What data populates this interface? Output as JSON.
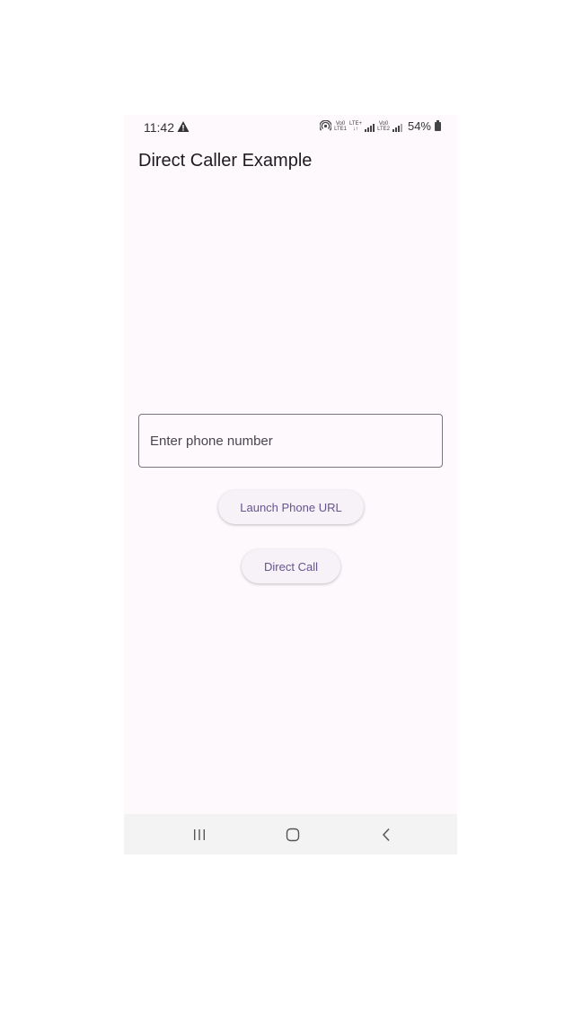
{
  "status_bar": {
    "time": "11:42",
    "battery_percent": "54%",
    "network_label_1_top": "Vo0",
    "network_label_1_bottom": "LTE1",
    "network_label_2_top": "LTE+",
    "network_label_2_bottom": "↓↑",
    "network_label_3_top": "Vo0",
    "network_label_3_bottom": "LTE2",
    "icons": [
      "warning-icon",
      "hotspot-icon",
      "signal-icon",
      "signal-icon",
      "battery-icon"
    ]
  },
  "app": {
    "title": "Direct Caller Example"
  },
  "phone_input": {
    "placeholder": "Enter phone number",
    "value": ""
  },
  "buttons": {
    "launch_label": "Launch Phone URL",
    "direct_label": "Direct Call"
  },
  "nav_bar": {
    "icons": [
      "recents-icon",
      "home-icon",
      "back-icon"
    ]
  },
  "colors": {
    "background": "#fdf9fd",
    "button_text": "#65558f",
    "button_bg": "#f7f1f8",
    "title_text": "#1d1b20",
    "input_border": "#7a757f"
  }
}
